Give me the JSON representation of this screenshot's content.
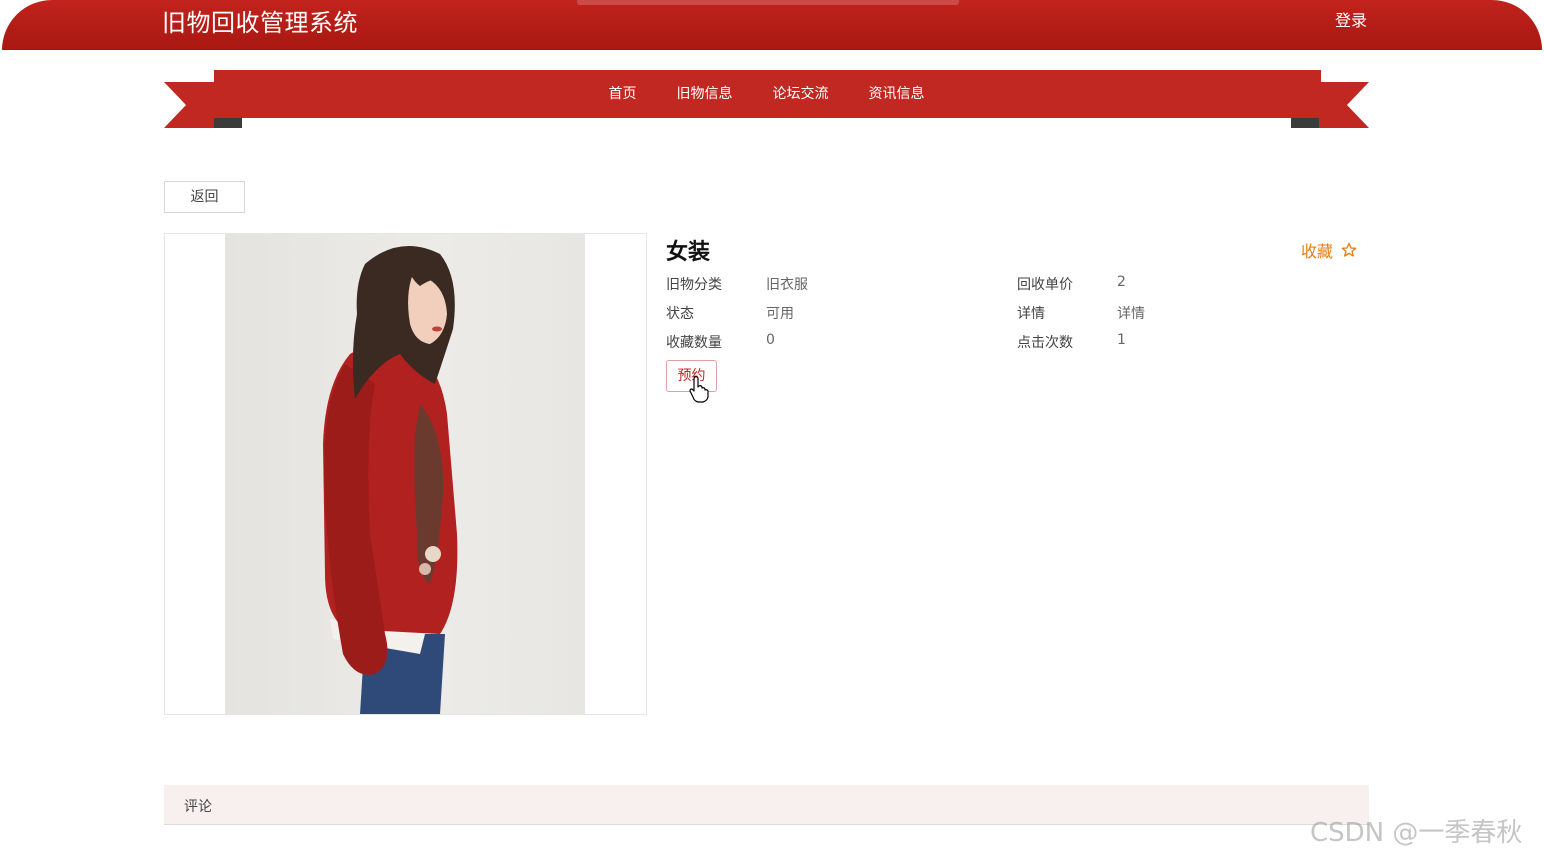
{
  "header": {
    "site_title": "旧物回收管理系统",
    "login_label": "登录"
  },
  "nav": {
    "items": [
      "首页",
      "旧物信息",
      "论坛交流",
      "资讯信息"
    ]
  },
  "back_label": "返回",
  "item": {
    "title": "女装",
    "favorite_label": "收藏",
    "fields": [
      {
        "label": "旧物分类",
        "value": "旧衣服"
      },
      {
        "label": "回收单价",
        "value": "2"
      },
      {
        "label": "状态",
        "value": "可用"
      },
      {
        "label": "详情",
        "value": "详情"
      },
      {
        "label": "收藏数量",
        "value": "0"
      },
      {
        "label": "点击次数",
        "value": "1"
      }
    ],
    "reserve_label": "预约"
  },
  "comments": {
    "label": "评论"
  },
  "watermark": "CSDN @一季春秋",
  "colors": {
    "brand_red": "#c2231d",
    "accent_orange": "#e57e16"
  },
  "icons": [
    "star-outline-icon",
    "hand-cursor-icon"
  ]
}
